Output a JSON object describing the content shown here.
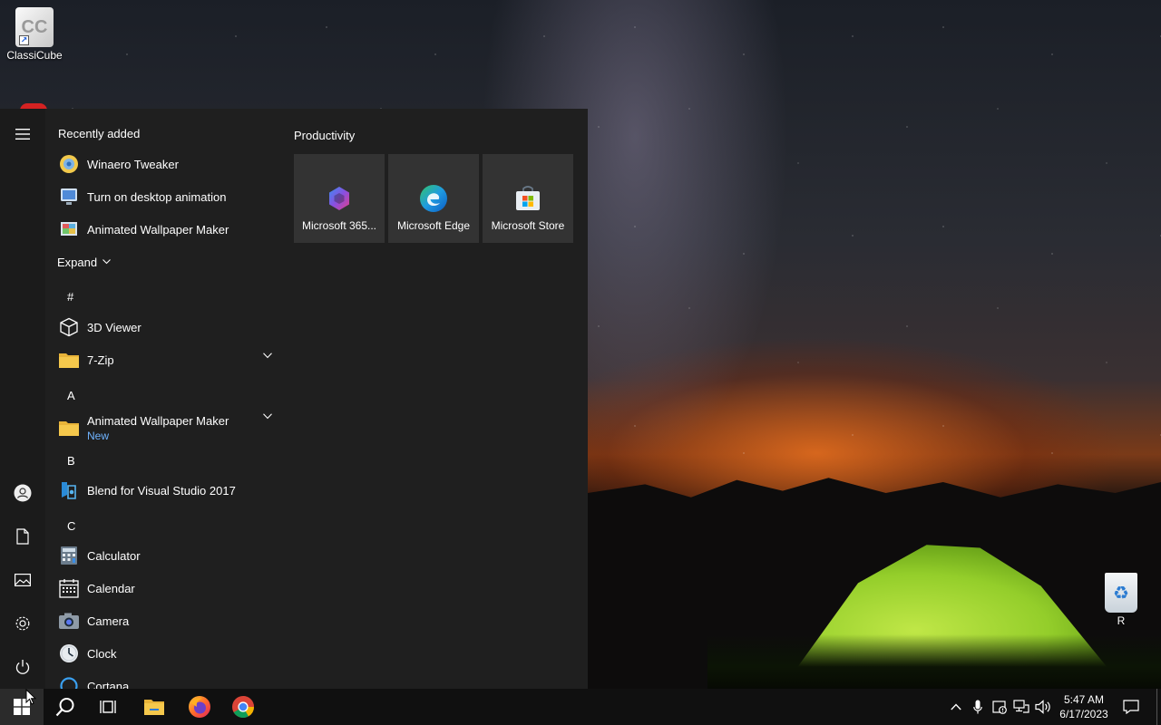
{
  "desktop": {
    "icons": [
      {
        "label": "ClassiCube",
        "glyph": "CC",
        "shortcut": "↗"
      },
      {
        "label": "R",
        "glyph": "♻"
      }
    ]
  },
  "start_menu": {
    "recently_added_title": "Recently added",
    "recent": [
      {
        "label": "Winaero Tweaker",
        "icon": "winaero-tweaker-icon"
      },
      {
        "label": "Turn on desktop animation",
        "icon": "monitor-icon"
      },
      {
        "label": "Animated Wallpaper Maker",
        "icon": "wallpaper-maker-icon"
      }
    ],
    "expand_label": "Expand",
    "sections": {
      "hash": "#",
      "a": "A",
      "b": "B",
      "c": "C"
    },
    "apps": {
      "viewer3d": "3D Viewer",
      "zip": "7-Zip",
      "awm": "Animated Wallpaper Maker",
      "awm_tag": "New",
      "blend": "Blend for Visual Studio 2017",
      "calculator": "Calculator",
      "calendar": "Calendar",
      "camera": "Camera",
      "clock": "Clock",
      "cortana": "Cortana"
    },
    "productivity": {
      "title": "Productivity",
      "tiles": [
        {
          "label": "Microsoft 365...",
          "icon": "microsoft-365-icon"
        },
        {
          "label": "Microsoft Edge",
          "icon": "edge-icon"
        },
        {
          "label": "Microsoft Store",
          "icon": "store-icon"
        }
      ]
    },
    "rail_icons": [
      "hamburger-icon",
      "user-icon",
      "document-icon",
      "pictures-icon",
      "settings-icon",
      "power-icon"
    ]
  },
  "taskbar": {
    "time": "5:47 AM",
    "date": "6/17/2023",
    "pinned": [
      "start-icon",
      "search-icon",
      "task-view-icon",
      "file-explorer-icon",
      "firefox-icon",
      "chrome-icon"
    ],
    "tray": [
      "chevron-up-icon",
      "microphone-icon",
      "security-icon",
      "network-icon",
      "volume-icon",
      "notification-icon"
    ]
  },
  "colors": {
    "start_bg": "#1f1f1f",
    "tile_bg": "#333333",
    "taskbar_bg": "#101010",
    "new_tag": "#6fb3ff"
  }
}
